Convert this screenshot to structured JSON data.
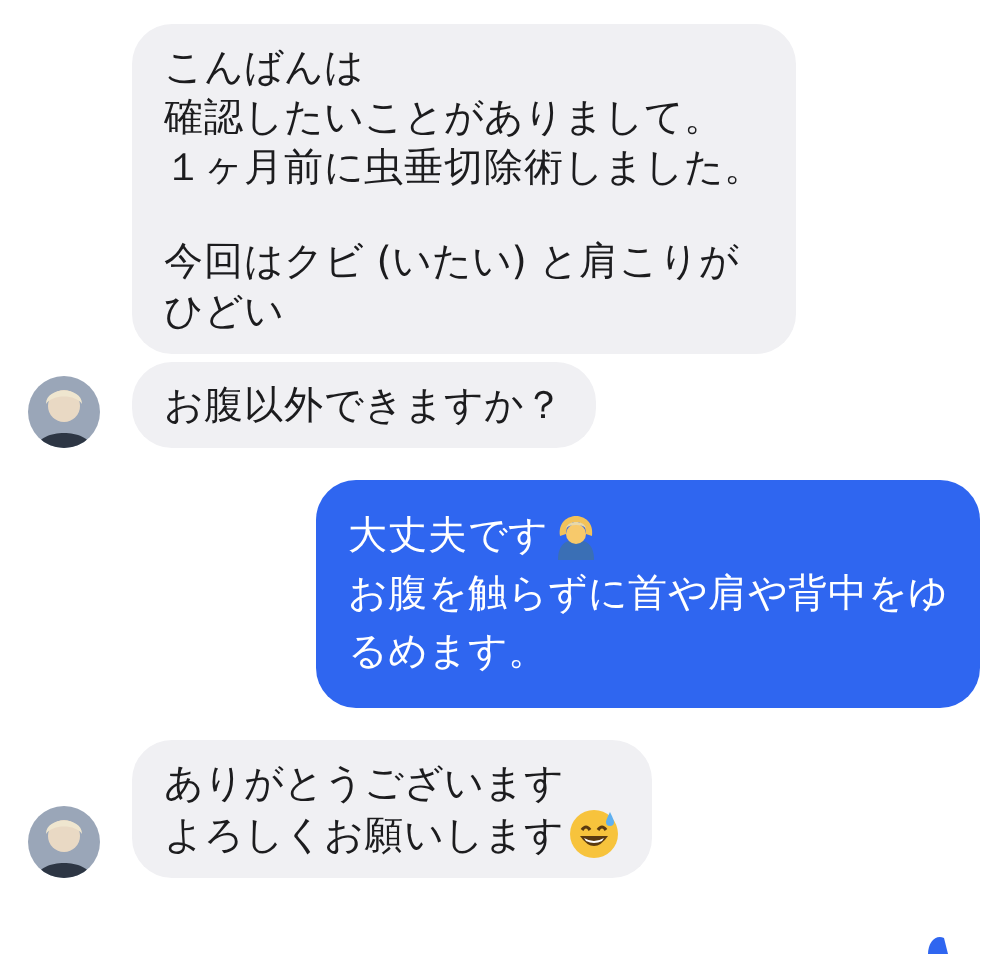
{
  "messages": [
    {
      "kind": "received",
      "avatar": false,
      "paragraphs": [
        [
          {
            "text": "こんばんは"
          },
          {
            "text": "確認したいことがありまして。"
          },
          {
            "text": "１ヶ月前に虫垂切除術しました。"
          }
        ],
        [
          {
            "text": "今回はクビ (いたい) と肩こりが"
          },
          {
            "text": "ひどい"
          }
        ]
      ]
    },
    {
      "kind": "received",
      "avatar": true,
      "paragraphs": [
        [
          {
            "text": "お腹以外できますか？"
          }
        ]
      ]
    },
    {
      "kind": "sent",
      "paragraphs": [
        [
          {
            "text": "大丈夫です",
            "kind": "gesture-emoji"
          },
          {
            "text": "お腹を触らずに首や肩や背中をゆ"
          },
          {
            "text": "るめます。"
          }
        ]
      ]
    },
    {
      "kind": "received",
      "avatar": true,
      "paragraphs": [
        [
          {
            "text": "ありがとうございます"
          },
          {
            "text": "よろしくお願いします",
            "kind": "smile-emoji"
          }
        ]
      ]
    }
  ],
  "seen_indicator": true
}
